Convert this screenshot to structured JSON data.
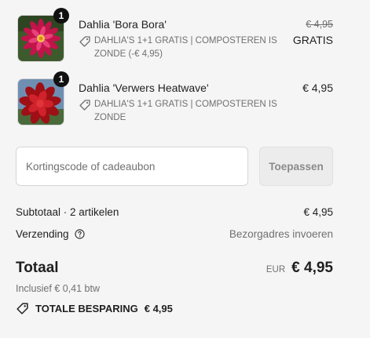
{
  "items": [
    {
      "quantity": "1",
      "name": "Dahlia 'Bora Bora'",
      "discount": "DAHLIA'S 1+1 GRATIS | COMPOSTEREN IS ZONDE (-€ 4,95)",
      "original_price": "€ 4,95",
      "price": "GRATIS",
      "image_icon": "pink-dahlia-photo"
    },
    {
      "quantity": "1",
      "name": "Dahlia 'Verwers Heatwave'",
      "discount": "DAHLIA'S 1+1 GRATIS | COMPOSTEREN IS ZONDE",
      "price": "€ 4,95",
      "image_icon": "red-dahlia-photo"
    }
  ],
  "discount_code": {
    "placeholder": "Kortingscode of cadeaubon",
    "value": "",
    "apply_label": "Toepassen"
  },
  "summary": {
    "subtotal_label": "Subtotaal · 2 artikelen",
    "subtotal_value": "€ 4,95",
    "shipping_label": "Verzending",
    "shipping_value": "Bezorgadres invoeren",
    "total_label": "Totaal",
    "currency": "EUR",
    "total_value": "€ 4,95",
    "tax_note": "Inclusief € 0,41 btw",
    "savings_label": "TOTALE BESPARING",
    "savings_value": "€ 4,95"
  },
  "colors": {
    "background": "#f5f5f5",
    "text": "#1f1f1f",
    "muted": "#707070",
    "badge": "#111111"
  }
}
